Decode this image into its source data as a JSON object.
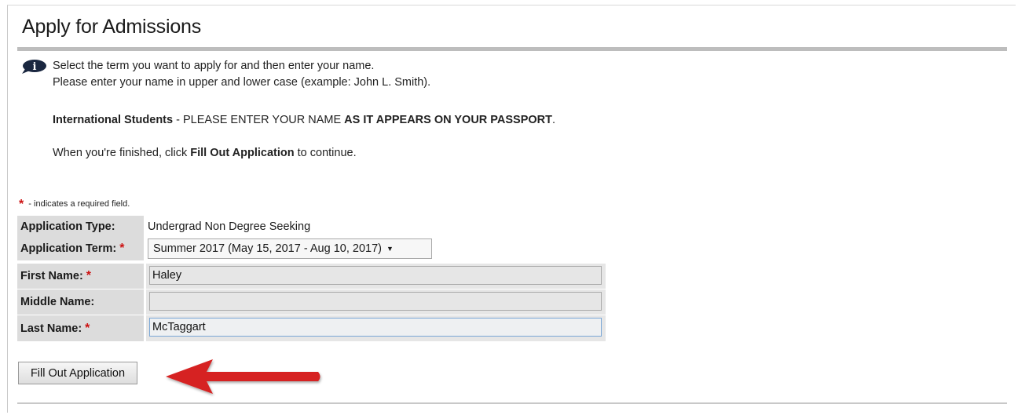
{
  "page": {
    "title": "Apply for Admissions"
  },
  "instructions": {
    "line1": "Select the term you want to apply for and then enter your name.",
    "line2": "Please enter your name in upper and lower case (example: John L. Smith).",
    "intl_bold": "International Students",
    "intl_mid": " - PLEASE ENTER YOUR NAME ",
    "intl_emph": "AS IT APPEARS ON YOUR PASSPORT",
    "intl_end": ".",
    "finish_pre": "When you're finished, click ",
    "finish_bold": "Fill Out Application",
    "finish_post": " to continue."
  },
  "required_note": {
    "star": "*",
    "text": " - indicates a required field."
  },
  "form": {
    "application_type": {
      "label": "Application Type:",
      "value": "Undergrad Non Degree Seeking"
    },
    "application_term": {
      "label": "Application Term:",
      "value": "Summer 2017 (May 15, 2017 - Aug 10, 2017)",
      "caret": "▼"
    },
    "first_name": {
      "label": "First Name:",
      "value": "Haley"
    },
    "middle_name": {
      "label": "Middle Name:",
      "value": ""
    },
    "last_name": {
      "label": "Last Name:",
      "value": "McTaggart"
    },
    "required_star": "*"
  },
  "buttons": {
    "submit": "Fill Out Application"
  },
  "colors": {
    "required": "#cc1111",
    "annotation_arrow": "#d62020",
    "label_bg": "#dcdcdc"
  },
  "icons": {
    "info": "info-speech-icon",
    "annotation": "red-arrow-left"
  }
}
